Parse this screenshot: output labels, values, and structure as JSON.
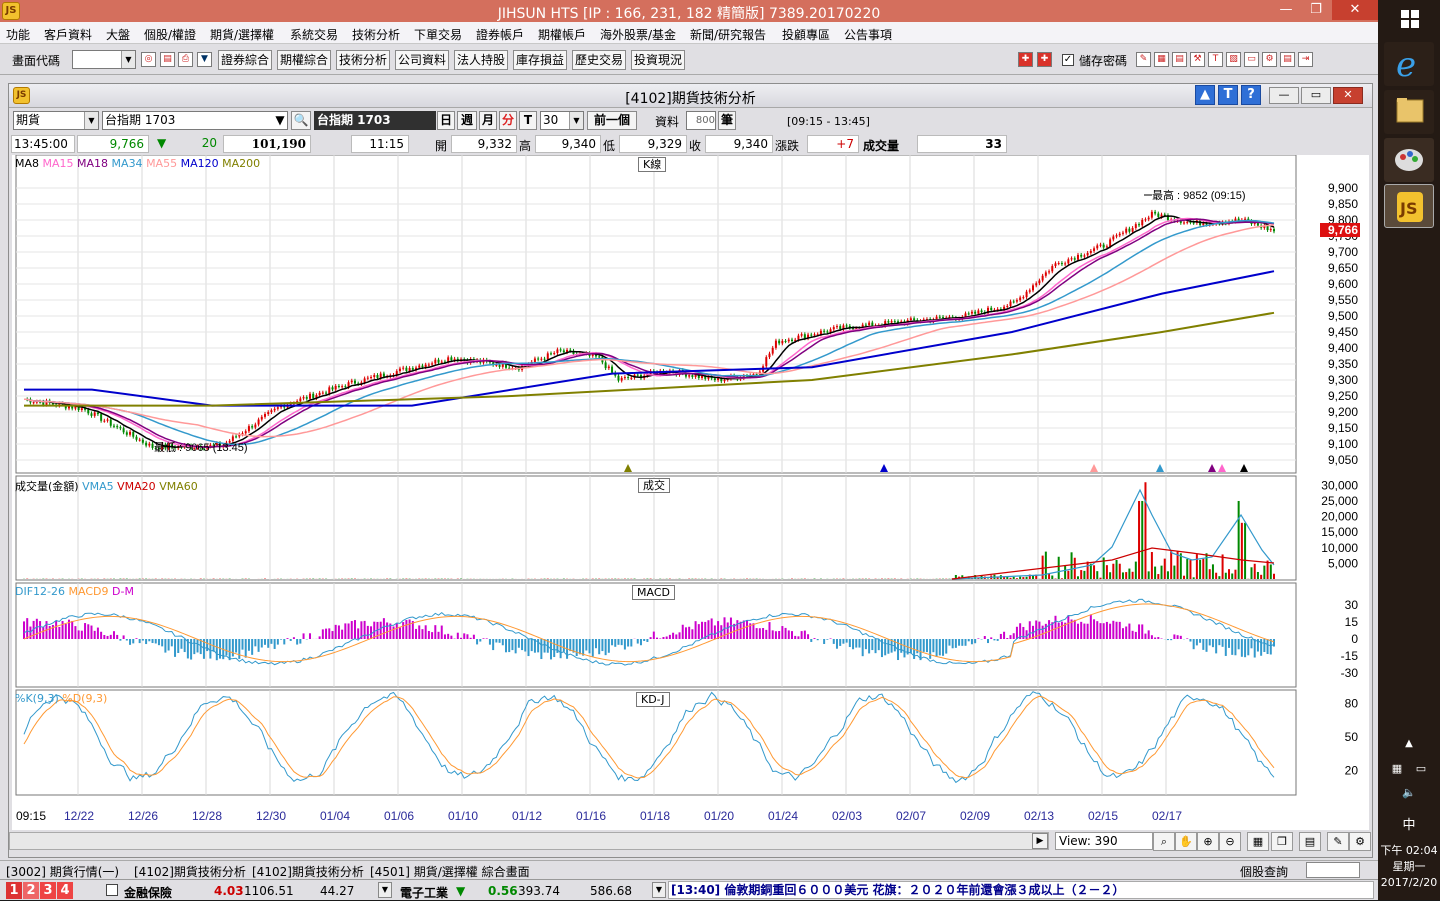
{
  "app": {
    "title": "JIHSUN HTS     [IP : 166, 231, 182 精簡版] 7389.20170220",
    "logo": "JS"
  },
  "menu": [
    "功能",
    "客戶資料",
    "大盤",
    "個股/權證",
    "期貨/選擇權",
    "系統交易",
    "技術分析",
    "下單交易",
    "證券帳戶",
    "期權帳戶",
    "海外股票/基金",
    "新聞/研究報告",
    "投顧專區",
    "公告事項"
  ],
  "toolbar": {
    "code_label": "畫面代碼",
    "buttons": [
      "證券綜合",
      "期權綜合",
      "技術分析",
      "公司資料",
      "法人持股",
      "庫存損益",
      "歷史交易",
      "投資現況"
    ],
    "save_pwd": "儲存密碼"
  },
  "window": {
    "title": "[4102]期貨技術分析",
    "help_icons": [
      "▲",
      "T",
      "?"
    ]
  },
  "controls": {
    "market": "期貨",
    "product": "台指期 1703",
    "product_label": "台指期 1703",
    "periods": [
      "日",
      "週",
      "月",
      "分",
      "T"
    ],
    "minutes": "30",
    "prev_label": "前一個",
    "data_label": "資料",
    "data_count": "800",
    "unit_label": "筆",
    "session": "[09:15 - 13:45]"
  },
  "quote": {
    "time": "13:45:00",
    "price": "9,766",
    "change_arrow": "▼",
    "change": "20",
    "volume_total": "101,190",
    "bar_time": "11:15",
    "open_label": "開",
    "open": "9,332",
    "high_label": "高",
    "high": "9,340",
    "low_label": "低",
    "low": "9,329",
    "close_label": "收",
    "close": "9,340",
    "chg_label": "漲跌",
    "chg": "+7",
    "vol_label": "成交量",
    "vol": "33"
  },
  "kline": {
    "legend": [
      {
        "name": "MA8",
        "color": "#000000"
      },
      {
        "name": "MA15",
        "color": "#ff66cc"
      },
      {
        "name": "MA18",
        "color": "#800080"
      },
      {
        "name": "MA34",
        "color": "#3399cc"
      },
      {
        "name": "MA55",
        "color": "#ff9999"
      },
      {
        "name": "MA120",
        "color": "#0000cc"
      },
      {
        "name": "MA200",
        "color": "#808000"
      }
    ],
    "title": "K線",
    "high_note": "最高 : 9852 (09:15)",
    "low_note": "最低 : 9065 (13:45)",
    "price_tag": "9,766",
    "yticks": [
      "9,900",
      "9,850",
      "9,800",
      "9,750",
      "9,700",
      "9,650",
      "9,600",
      "9,550",
      "9,500",
      "9,450",
      "9,400",
      "9,350",
      "9,300",
      "9,250",
      "9,200",
      "9,150",
      "9,100",
      "9,050"
    ]
  },
  "volume": {
    "legend": [
      {
        "name": "成交量(金額)",
        "color": "#000000"
      },
      {
        "name": "VMA5",
        "color": "#3399cc"
      },
      {
        "name": "VMA20",
        "color": "#cc0000"
      },
      {
        "name": "VMA60",
        "color": "#808000"
      }
    ],
    "title": "成交",
    "yticks": [
      "30,000",
      "25,000",
      "20,000",
      "15,000",
      "10,000",
      "5,000"
    ]
  },
  "macd": {
    "legend": [
      {
        "name": "DIF12-26",
        "color": "#3399cc"
      },
      {
        "name": "MACD9",
        "color": "#ff9933"
      },
      {
        "name": "D-M",
        "color": "#cc00cc"
      }
    ],
    "title": "MACD",
    "yticks": [
      "30",
      "15",
      "0",
      "-15",
      "-30"
    ]
  },
  "kd": {
    "legend": [
      {
        "name": "%K(9,3)",
        "color": "#3399cc"
      },
      {
        "name": "%D(9,3)",
        "color": "#ff9933"
      }
    ],
    "title": "KD-J",
    "yticks": [
      "80",
      "50",
      "20"
    ]
  },
  "xaxis": [
    "09:15",
    "12/22",
    "12/26",
    "12/28",
    "12/30",
    "01/04",
    "01/06",
    "01/10",
    "01/12",
    "01/16",
    "01/18",
    "01/20",
    "01/24",
    "02/03",
    "02/07",
    "02/09",
    "02/13",
    "02/15",
    "02/17"
  ],
  "bottom": {
    "view_label": "View: 390"
  },
  "tabs": [
    "[3002] 期貨行情(一)",
    "[4102]期貨技術分析",
    "[4102]期貨技術分析",
    "[4501] 期貨/選擇權 綜合畫面"
  ],
  "stock_query": "個股查詢",
  "status": {
    "nums": [
      "1",
      "2",
      "3",
      "4"
    ],
    "items": [
      {
        "name": "金融保險",
        "chg": "4.03",
        "val": "1106.51",
        "amt": "44.27",
        "dir": ""
      },
      {
        "name": "電子工業",
        "chg": "0.56",
        "val": "393.74",
        "amt": "586.68",
        "dir": "▼"
      }
    ],
    "ticker": "[13:40] 倫敦期銅重回６０００美元 花旗：２０２０年前還會漲３成以上（２－２）"
  },
  "tray": {
    "time": "下午 02:04",
    "weekday": "星期一",
    "date": "2017/2/20",
    "ime": "中"
  },
  "colors": {
    "titlebar": "#d46f5d",
    "up": "#cc0000",
    "down": "#008800",
    "ma120": "#0000cc",
    "ma200": "#808000"
  }
}
